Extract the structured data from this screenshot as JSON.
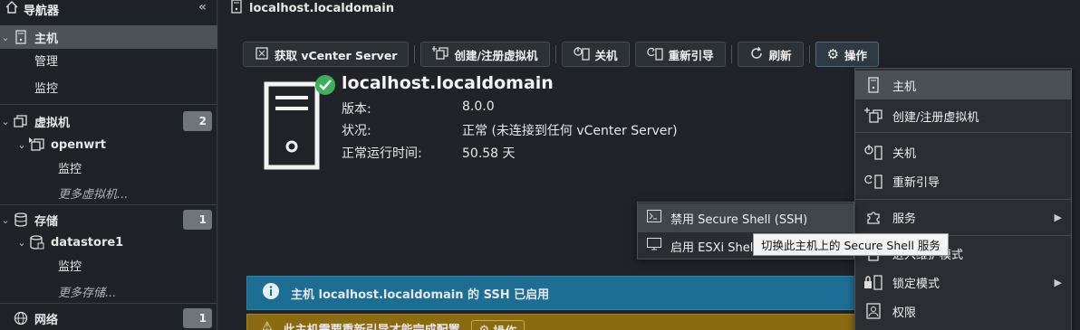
{
  "sidebar": {
    "title": "导航器",
    "items": [
      {
        "label": "主机"
      },
      {
        "label": "管理"
      },
      {
        "label": "监控"
      },
      {
        "label": "虚拟机",
        "count": "2"
      },
      {
        "label": "openwrt"
      },
      {
        "label": "监控"
      },
      {
        "label": "更多虚拟机..."
      },
      {
        "label": "存储",
        "count": "1"
      },
      {
        "label": "datastore1"
      },
      {
        "label": "监控"
      },
      {
        "label": "更多存储..."
      },
      {
        "label": "网络",
        "count": "1"
      }
    ]
  },
  "header": {
    "title": "localhost.localdomain"
  },
  "toolbar": {
    "buttons": [
      {
        "label": "获取 vCenter Server"
      },
      {
        "label": "创建/注册虚拟机"
      },
      {
        "label": "关机"
      },
      {
        "label": "重新引导"
      },
      {
        "label": "刷新"
      },
      {
        "label": "操作"
      }
    ]
  },
  "host": {
    "name": "localhost.localdomain",
    "rows": [
      {
        "key": "版本:",
        "value": "8.0.0"
      },
      {
        "key": "状况:",
        "value": "正常 (未连接到任何 vCenter Server)"
      },
      {
        "key": "正常运行时间:",
        "value": "50.58 天"
      }
    ]
  },
  "banners": {
    "info": "主机 localhost.localdomain 的 SSH 已启用",
    "warn": "此主机需要重新引导才能完成配置",
    "warn_button": "操作"
  },
  "menu": {
    "items": [
      {
        "label": "主机"
      },
      {
        "label": "创建/注册虚拟机"
      },
      {
        "label": "关机"
      },
      {
        "label": "重新引导"
      },
      {
        "label": "服务"
      },
      {
        "label": "进入维护模式"
      },
      {
        "label": "锁定模式"
      },
      {
        "label": "权限"
      }
    ]
  },
  "submenu": {
    "items": [
      {
        "label": "禁用 Secure Shell (SSH)"
      },
      {
        "label": "启用 ESXi Shell"
      }
    ]
  },
  "tooltip": "切换此主机上的 Secure Shell 服务",
  "colors": {
    "info_banner": "#1c6e94",
    "warn_banner": "#8a6b12",
    "status_ok": "#3fae5a"
  }
}
